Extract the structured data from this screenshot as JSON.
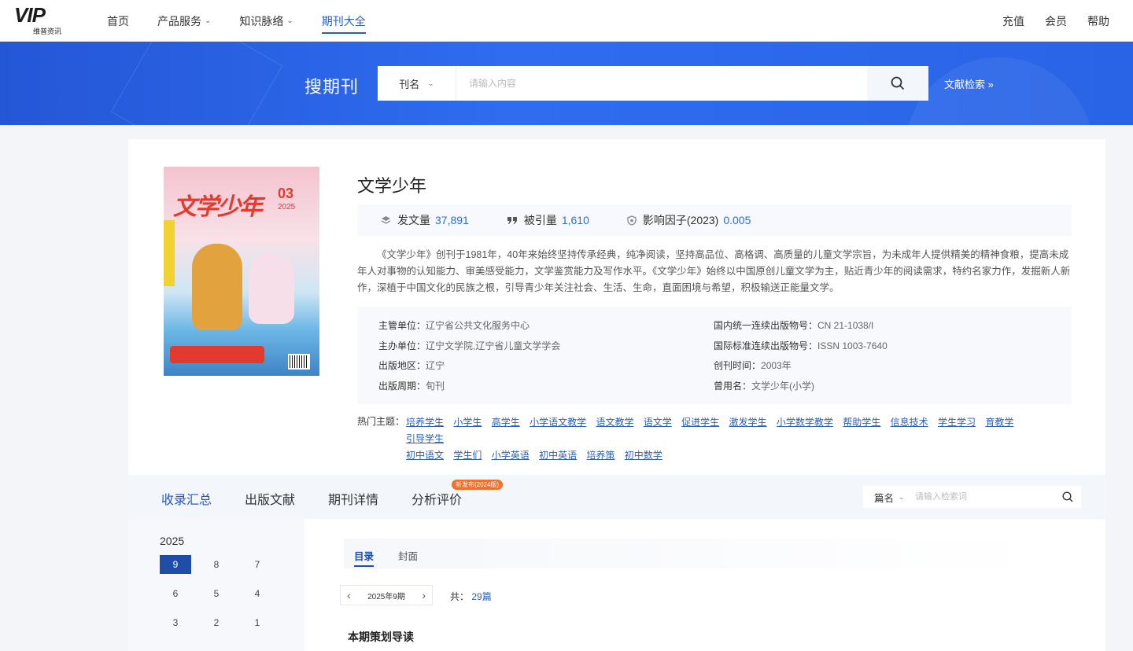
{
  "logo": {
    "brand": "VIP",
    "subtitle": "维普资讯"
  },
  "nav": {
    "items": [
      {
        "label": "首页",
        "has_menu": false,
        "active": false
      },
      {
        "label": "产品服务",
        "has_menu": true,
        "active": false
      },
      {
        "label": "知识脉络",
        "has_menu": true,
        "active": false
      },
      {
        "label": "期刊大全",
        "has_menu": false,
        "active": true
      }
    ],
    "right": [
      "充值",
      "会员",
      "帮助"
    ]
  },
  "banner": {
    "title": "搜期刊",
    "search_type": "刊名",
    "search_placeholder": "请输入内容",
    "advanced_link": "文献检索 »"
  },
  "journal": {
    "title": "文学少年",
    "cover": {
      "title_text": "文学少年",
      "issue_number": "03",
      "year": "2025"
    },
    "stats": [
      {
        "icon": "layers-icon",
        "label": "发文量",
        "value": "37,891"
      },
      {
        "icon": "quote-icon",
        "label": "被引量",
        "value": "1,610"
      },
      {
        "icon": "shield-icon",
        "label": "影响因子(2023)",
        "value": "0.005"
      }
    ],
    "description": "《文学少年》创刊于1981年，40年来始终坚持传承经典，纯净阅读，坚持高品位、高格调、高质量的儿童文学宗旨，为未成年人提供精美的精神食粮，提高未成年人对事物的认知能力、审美感受能力，文学鉴赏能力及写作水平。《文学少年》始终以中国原创儿童文学为主，贴近青少年的阅读需求，特约名家力作，发掘新人新作，深植于中国文化的民族之根，引导青少年关注社会、生活、生命，直面困境与希望，积极输送正能量文学。",
    "info_left": [
      {
        "label": "主管单位：",
        "value": "辽宁省公共文化服务中心"
      },
      {
        "label": "主办单位：",
        "value": "辽宁文学院,辽宁省儿童文学学会"
      },
      {
        "label": "出版地区：",
        "value": "辽宁"
      },
      {
        "label": "出版周期：",
        "value": "旬刊"
      }
    ],
    "info_right": [
      {
        "label": "国内统一连续出版物号：",
        "value": "CN 21-1038/I"
      },
      {
        "label": "国际标准连续出版物号：",
        "value": "ISSN 1003-7640"
      },
      {
        "label": "创刊时间：",
        "value": "2003年"
      },
      {
        "label": "曾用名：",
        "value": "文学少年(小学)"
      }
    ],
    "hot_label": "热门主题：",
    "hot_topics": [
      "培养学生",
      "小学生",
      "高学生",
      "小学语文教学",
      "语文教学",
      "语文学",
      "促进学生",
      "激发学生",
      "小学数学教学",
      "帮助学生",
      "信息技术",
      "学生学习",
      "育教学",
      "引导学生",
      "初中语文",
      "学生们",
      "小学英语",
      "初中英语",
      "培养策",
      "初中数学"
    ]
  },
  "tabs": {
    "items": [
      "收录汇总",
      "出版文献",
      "期刊详情",
      "分析评价"
    ],
    "active": 0,
    "new_badge": "新发布(2024版)",
    "search_type": "篇名",
    "search_placeholder": "请输入检索词"
  },
  "issues": {
    "year": "2025",
    "list": [
      "9",
      "8",
      "7",
      "6",
      "5",
      "4",
      "3",
      "2",
      "1"
    ],
    "selected": "9"
  },
  "toc": {
    "tabs": [
      "目录",
      "封面"
    ],
    "current_issue": "2025年9期",
    "total_label": "共：",
    "total_value": "29篇",
    "section_title": "本期策划导读"
  },
  "colors": {
    "accent": "#1f5fd1",
    "banner": "#2f6cf0",
    "link": "#2d5fb5",
    "badge": "#f0702c"
  }
}
